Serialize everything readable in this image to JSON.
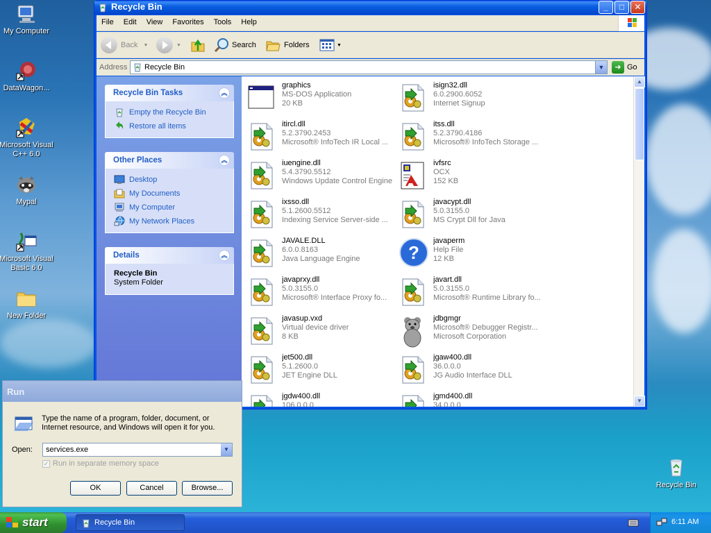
{
  "desktop": {
    "icons": [
      {
        "label": "My Computer",
        "icon": "my-computer-icon"
      },
      {
        "label": "DataWagon...",
        "icon": "datawagon-shortcut-icon"
      },
      {
        "label": "Microsoft Visual C++ 6.0",
        "icon": "visual-cpp-shortcut-icon"
      },
      {
        "label": "Mypal",
        "icon": "mypal-raccoon-icon"
      },
      {
        "label": "Microsoft Visual Basic 6.0",
        "icon": "visual-basic-shortcut-icon"
      },
      {
        "label": "New Folder",
        "icon": "folder-icon"
      },
      {
        "label": "Recycle Bin",
        "icon": "recycle-bin-icon"
      }
    ]
  },
  "window": {
    "title": "Recycle Bin",
    "menu": [
      "File",
      "Edit",
      "View",
      "Favorites",
      "Tools",
      "Help"
    ],
    "toolbar": {
      "back": "Back",
      "search": "Search",
      "folders": "Folders"
    },
    "address": {
      "label": "Address",
      "value": "Recycle Bin",
      "go": "Go"
    },
    "panels": {
      "tasks": {
        "title": "Recycle Bin Tasks",
        "links": [
          "Empty the Recycle Bin",
          "Restore all items"
        ]
      },
      "places": {
        "title": "Other Places",
        "links": [
          "Desktop",
          "My Documents",
          "My Computer",
          "My Network Places"
        ]
      },
      "details": {
        "title": "Details",
        "name": "Recycle Bin",
        "type": "System Folder"
      }
    },
    "files": [
      {
        "name": "graphics",
        "l1": "MS-DOS Application",
        "l2": "20 KB",
        "icon": "msdos-window-icon"
      },
      {
        "name": "isign32.dll",
        "l1": "6.0.2900.6052",
        "l2": "Internet Signup",
        "icon": "dll-gear-icon"
      },
      {
        "name": "itircl.dll",
        "l1": "5.2.3790.2453",
        "l2": "Microsoft® InfoTech IR Local ...",
        "icon": "dll-gear-icon"
      },
      {
        "name": "itss.dll",
        "l1": "5.2.3790.4186",
        "l2": "Microsoft® InfoTech Storage ...",
        "icon": "dll-gear-icon"
      },
      {
        "name": "iuengine.dll",
        "l1": "5.4.3790.5512",
        "l2": "Windows Update Control Engine",
        "icon": "dll-gear-icon"
      },
      {
        "name": "ivfsrc",
        "l1": "OCX",
        "l2": "152 KB",
        "icon": "ocx-icon"
      },
      {
        "name": "ixsso.dll",
        "l1": "5.1.2600.5512",
        "l2": "Indexing Service Server-side ...",
        "icon": "dll-gear-icon"
      },
      {
        "name": "javacypt.dll",
        "l1": "5.0.3155.0",
        "l2": "MS Crypt Dll for Java",
        "icon": "dll-gear-icon"
      },
      {
        "name": "JAVALE.DLL",
        "l1": "6.0.0.8163",
        "l2": "Java Language Engine",
        "icon": "dll-gear-icon"
      },
      {
        "name": "javaperm",
        "l1": "Help File",
        "l2": "12 KB",
        "icon": "help-file-icon"
      },
      {
        "name": "javaprxy.dll",
        "l1": "5.0.3155.0",
        "l2": "Microsoft® Interface Proxy fo...",
        "icon": "dll-gear-icon"
      },
      {
        "name": "javart.dll",
        "l1": "5.0.3155.0",
        "l2": "Microsoft® Runtime Library fo...",
        "icon": "dll-gear-icon"
      },
      {
        "name": "javasup.vxd",
        "l1": "Virtual device driver",
        "l2": "8 KB",
        "icon": "dll-gear-icon"
      },
      {
        "name": "jdbgmgr",
        "l1": "Microsoft® Debugger Registr...",
        "l2": "Microsoft Corporation",
        "icon": "teddy-bear-icon"
      },
      {
        "name": "jet500.dll",
        "l1": "5.1.2600.0",
        "l2": "JET Engine DLL",
        "icon": "dll-gear-icon"
      },
      {
        "name": "jgaw400.dll",
        "l1": "36.0.0.0",
        "l2": "JG Audio Interface DLL",
        "icon": "dll-gear-icon"
      },
      {
        "name": "jgdw400.dll",
        "l1": "106.0.0.0",
        "l2": "",
        "icon": "dll-gear-icon"
      },
      {
        "name": "jgmd400.dll",
        "l1": "34.0.0.0",
        "l2": "",
        "icon": "dll-gear-icon"
      }
    ]
  },
  "run": {
    "title": "Run",
    "text": "Type the name of a program, folder, document, or Internet resource, and Windows will open it for you.",
    "open_label": "Open:",
    "value": "services.exe",
    "checkbox": "Run in separate memory space",
    "ok": "OK",
    "cancel": "Cancel",
    "browse": "Browse..."
  },
  "taskbar": {
    "start": "start",
    "task": "Recycle Bin",
    "time": "6:11 AM"
  }
}
